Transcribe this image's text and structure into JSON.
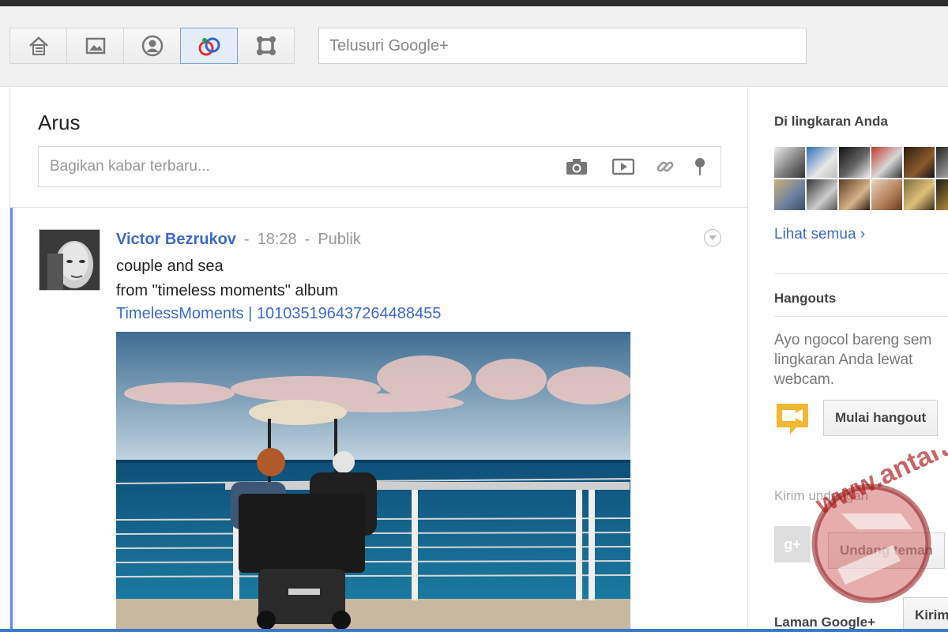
{
  "toolbar": {
    "nav": [
      {
        "name": "home-icon"
      },
      {
        "name": "photos-icon"
      },
      {
        "name": "profile-icon"
      },
      {
        "name": "circles-icon"
      },
      {
        "name": "games-icon"
      }
    ],
    "active_index": 3,
    "search_placeholder": "Telusuri Google+"
  },
  "stream": {
    "title": "Arus",
    "share_placeholder": "Bagikan kabar terbaru...",
    "share_icons": [
      "camera-icon",
      "video-icon",
      "link-icon",
      "location-icon"
    ]
  },
  "post": {
    "author": "Victor Bezrukov",
    "time": "18:28",
    "visibility": "Publik",
    "separator": "-",
    "text_line1": "couple and sea",
    "text_line2": "from \"timeless moments\" album",
    "link": "TimelessMoments | 101035196437264488455"
  },
  "sidebar": {
    "circles_title": "Di lingkaran Anda",
    "see_all": "Lihat semua ›",
    "hangouts_title": "Hangouts",
    "hangouts_text": "Ayo ngocol bareng sem lingkaran Anda lewat webcam.",
    "hangout_button": "Mulai hangout",
    "invite_title": "Kirim undangan",
    "invite_button": "Undang teman",
    "pages_title": "Laman Google+",
    "send_button": "Kirim"
  },
  "watermark": {
    "text": "www.antaranews.com"
  },
  "colors": {
    "accent": "#3d6ac9",
    "toolbar_bg": "#f1f1f1",
    "hangout_yellow": "#f2b733"
  }
}
